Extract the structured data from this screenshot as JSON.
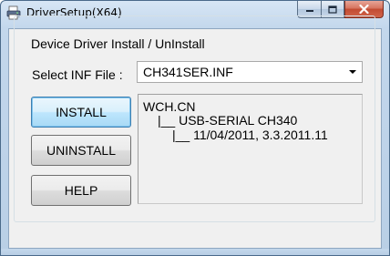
{
  "window": {
    "title": "DriverSetup(X64)",
    "icon": "printer-app-icon"
  },
  "caption_buttons": {
    "minimize": "minimize-icon",
    "maximize": "maximize-icon",
    "close": "close-icon"
  },
  "group": {
    "title": "Device Driver Install / UnInstall"
  },
  "inf": {
    "label": "Select INF File :",
    "selected": "CH341SER.INF"
  },
  "buttons": {
    "install": "INSTALL",
    "uninstall": "UNINSTALL",
    "help": "HELP"
  },
  "info": {
    "vendor": "WCH.CN",
    "device": "|__ USB-SERIAL CH340",
    "version": "|__ 11/04/2011, 3.3.2011.11"
  },
  "colors": {
    "title_bar": "#c3d7ec",
    "client_bg": "#f0f0f0",
    "close_button": "#c24b32",
    "default_button": "#bee6fd"
  }
}
